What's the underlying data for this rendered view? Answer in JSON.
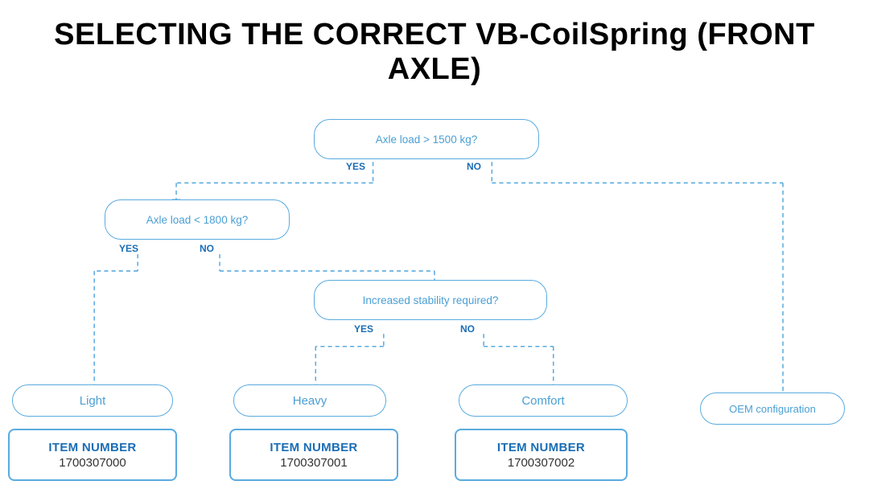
{
  "title": "SELECTING THE CORRECT VB-CoilSpring (FRONT AXLE)",
  "nodes": {
    "q1": {
      "label": "Axle load > 1500 kg?",
      "yes": "YES",
      "no": "NO"
    },
    "q2": {
      "label": "Axle load < 1800 kg?",
      "yes": "YES",
      "no": "NO"
    },
    "q3": {
      "label": "Increased stability required?",
      "yes": "YES",
      "no": "NO"
    },
    "r_light": {
      "label": "Light"
    },
    "r_heavy": {
      "label": "Heavy"
    },
    "r_comfort": {
      "label": "Comfort"
    },
    "r_oem": {
      "label": "OEM configuration"
    }
  },
  "items": {
    "item0": {
      "label": "ITEM NUMBER",
      "number": "1700307000"
    },
    "item1": {
      "label": "ITEM NUMBER",
      "number": "1700307001"
    },
    "item2": {
      "label": "ITEM NUMBER",
      "number": "1700307002"
    }
  }
}
